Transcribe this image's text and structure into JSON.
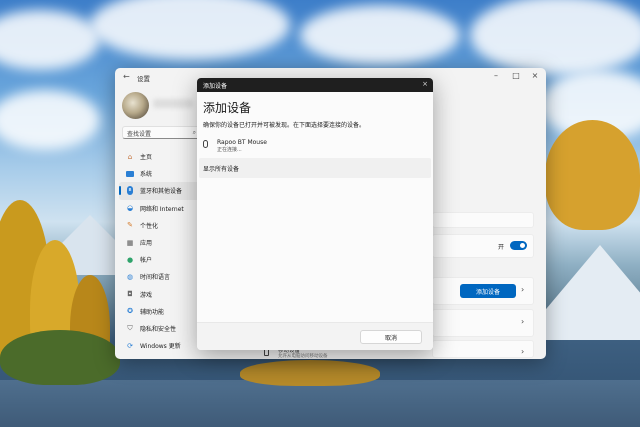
{
  "settings": {
    "title": "设置",
    "search_placeholder": "查找设置",
    "nav": [
      {
        "label": "主页",
        "icon": "home-icon",
        "active": false
      },
      {
        "label": "系统",
        "icon": "display-icon",
        "active": false
      },
      {
        "label": "蓝牙和其他设备",
        "icon": "bluetooth-icon",
        "active": true
      },
      {
        "label": "网络和 Internet",
        "icon": "wifi-icon",
        "active": false
      },
      {
        "label": "个性化",
        "icon": "brush-icon",
        "active": false
      },
      {
        "label": "应用",
        "icon": "apps-icon",
        "active": false
      },
      {
        "label": "帐户",
        "icon": "user-icon",
        "active": false
      },
      {
        "label": "时间和语言",
        "icon": "globe-clock-icon",
        "active": false
      },
      {
        "label": "游戏",
        "icon": "gamepad-icon",
        "active": false
      },
      {
        "label": "辅助功能",
        "icon": "accessibility-icon",
        "active": false
      },
      {
        "label": "隐私和安全性",
        "icon": "shield-icon",
        "active": false
      },
      {
        "label": "Windows 更新",
        "icon": "update-icon",
        "active": false
      }
    ],
    "toggle_label": "开",
    "add_device_label": "添加设备",
    "mobile_row_title": "移动设备",
    "mobile_row_sub": "允许从电脑访问移动设备"
  },
  "dialog": {
    "window_title": "添加设备",
    "heading": "添加设备",
    "description": "确保你的设备已打开并可被发现。在下面选择要连接的设备。",
    "device": {
      "name": "Rapoo BT Mouse",
      "status": "正在连接..."
    },
    "show_all_label": "显示所有设备",
    "cancel_label": "取消"
  },
  "colors": {
    "accent": "#0067c0",
    "dialog_titlebar": "#1f1f1f"
  }
}
